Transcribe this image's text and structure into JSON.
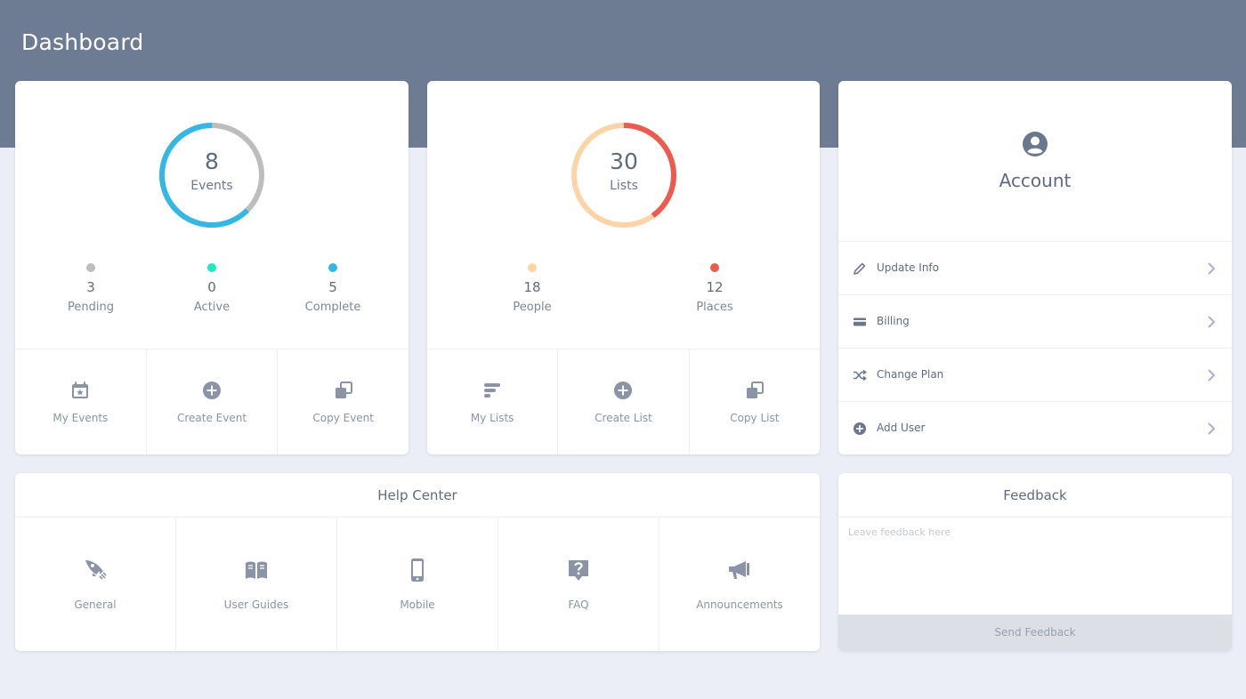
{
  "header": {
    "title": "Dashboard"
  },
  "events": {
    "total": "8",
    "label": "Events",
    "stats": [
      {
        "value": "3",
        "label": "Pending",
        "color": "#bdbdbd"
      },
      {
        "value": "0",
        "label": "Active",
        "color": "#1de9c8"
      },
      {
        "value": "5",
        "label": "Complete",
        "color": "#33b8e6"
      }
    ],
    "actions": [
      {
        "label": "My Events",
        "icon": "calendar-star-icon"
      },
      {
        "label": "Create Event",
        "icon": "plus-circle-icon"
      },
      {
        "label": "Copy Event",
        "icon": "copy-icon"
      }
    ]
  },
  "lists": {
    "total": "30",
    "label": "Lists",
    "stats": [
      {
        "value": "18",
        "label": "People",
        "color": "#fdd4a6"
      },
      {
        "value": "12",
        "label": "Places",
        "color": "#ec5a50"
      }
    ],
    "actions": [
      {
        "label": "My Lists",
        "icon": "list-icon"
      },
      {
        "label": "Create List",
        "icon": "plus-circle-icon"
      },
      {
        "label": "Copy List",
        "icon": "copy-icon"
      }
    ]
  },
  "account": {
    "title": "Account",
    "icon": "user-circle-icon",
    "items": [
      {
        "label": "Update Info",
        "icon": "pencil-icon"
      },
      {
        "label": "Billing",
        "icon": "credit-card-icon"
      },
      {
        "label": "Change Plan",
        "icon": "shuffle-icon"
      },
      {
        "label": "Add User",
        "icon": "plus-circle-icon"
      }
    ]
  },
  "help": {
    "title": "Help Center",
    "items": [
      {
        "label": "General",
        "icon": "rocket-icon"
      },
      {
        "label": "User Guides",
        "icon": "book-icon"
      },
      {
        "label": "Mobile",
        "icon": "mobile-icon"
      },
      {
        "label": "FAQ",
        "icon": "question-icon"
      },
      {
        "label": "Announcements",
        "icon": "megaphone-icon"
      }
    ]
  },
  "feedback": {
    "title": "Feedback",
    "placeholder": "Leave feedback here",
    "button_label": "Send Feedback"
  },
  "colors": {
    "header": "#6e7c93",
    "background": "#ebeef6",
    "icon": "#8a94a6",
    "events_ring_remaining": "#bdbdbd"
  }
}
